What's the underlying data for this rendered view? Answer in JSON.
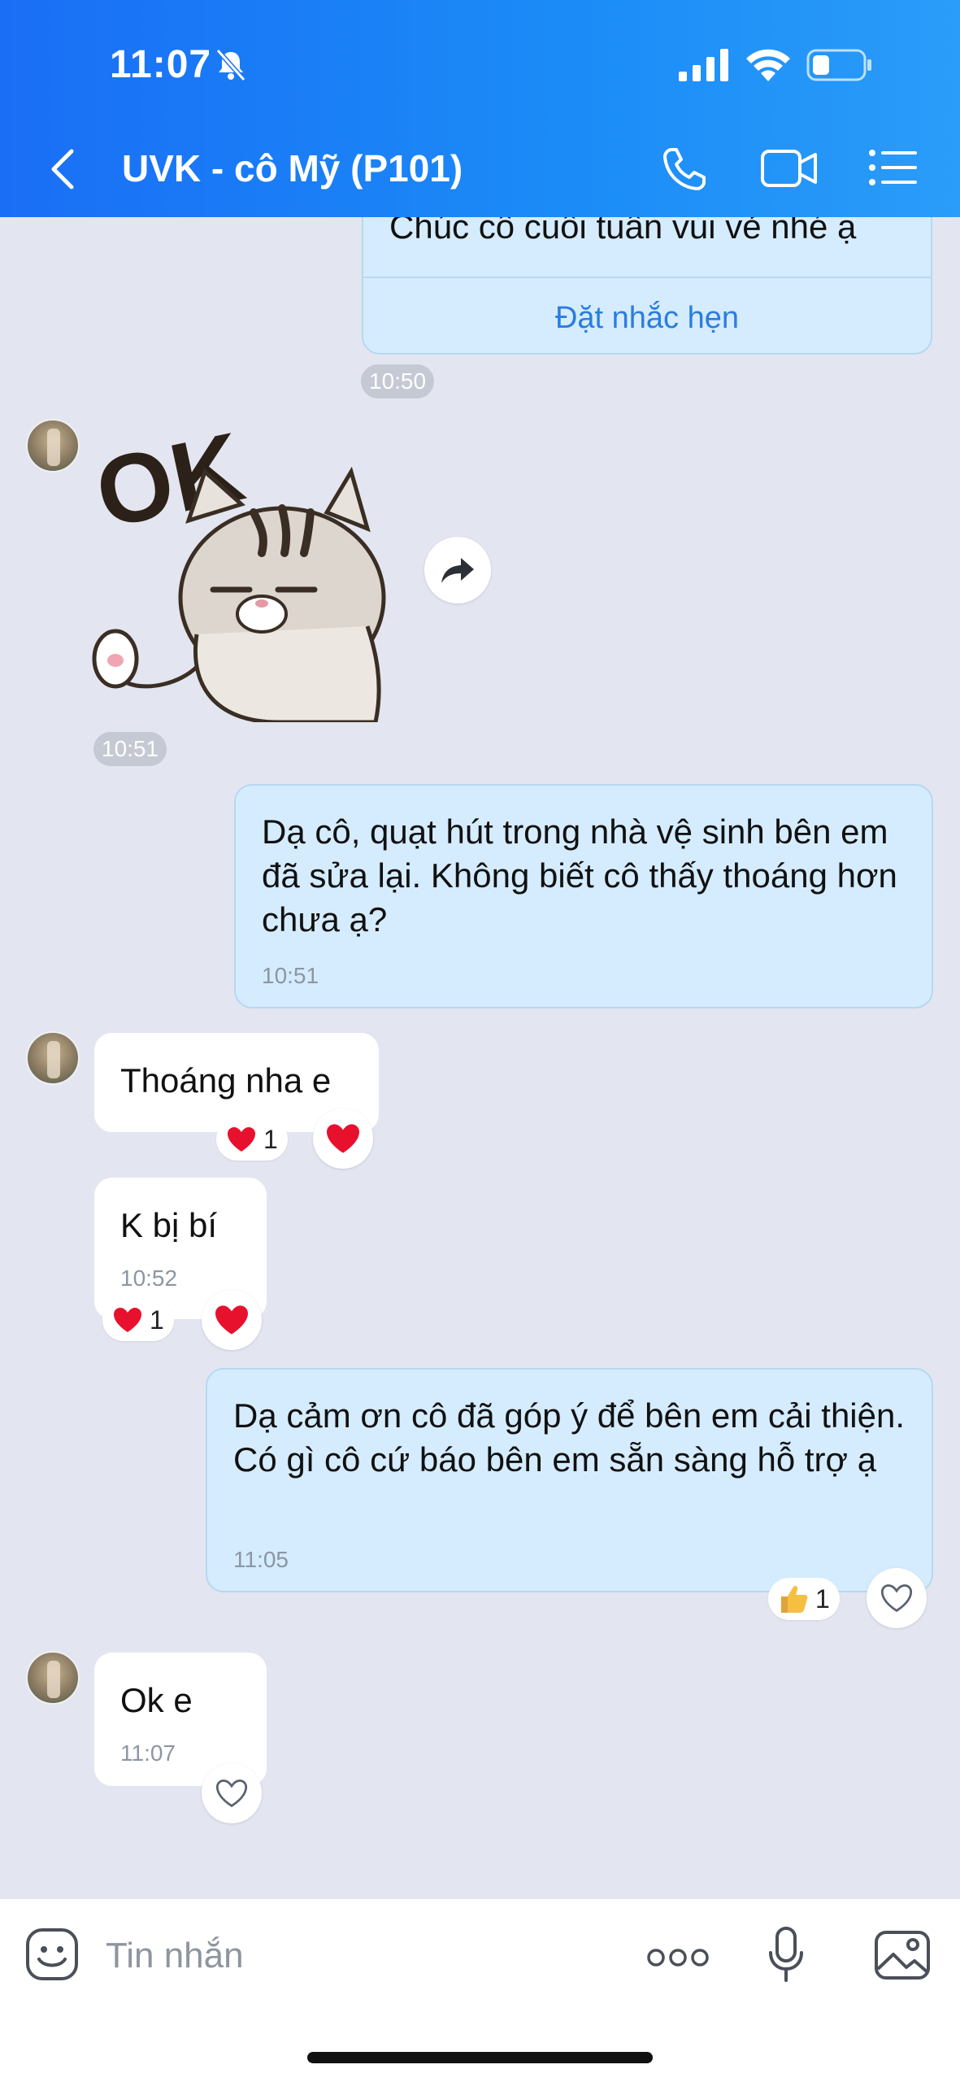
{
  "status_bar": {
    "time": "11:07"
  },
  "header": {
    "title": "UVK - cô Mỹ (P101)"
  },
  "messages": {
    "m0": {
      "text": "Chúc cô cuối tuần vui vẻ nhé ạ",
      "action": "Đặt nhắc hẹn",
      "time": "10:50"
    },
    "m1": {
      "sticker_text": "OK",
      "time": "10:51"
    },
    "m2": {
      "text": "Dạ cô, quạt hút trong nhà vệ sinh bên em đã sửa lại. Không biết cô thấy thoáng hơn chưa ạ?",
      "time": "10:51"
    },
    "m3": {
      "text": "Thoáng nha e",
      "reaction_count": "1"
    },
    "m4": {
      "text": "K bị bí",
      "time": "10:52",
      "reaction_count": "1"
    },
    "m5": {
      "text": "Dạ cảm ơn cô đã góp ý để bên em cải thiện. Có gì cô cứ báo bên em sẵn sàng hỗ trợ ạ",
      "time": "11:05",
      "reaction_count": "1"
    },
    "m6": {
      "text": "Ok e",
      "time": "11:07"
    }
  },
  "input": {
    "placeholder": "Tin nhắn"
  },
  "colors": {
    "header": "#1a7cf6",
    "outgoing_bubble": "#d5ecff",
    "incoming_bubble": "#ffffff",
    "background": "#e3e6f0",
    "link": "#2a7de1",
    "heart": "#e8112d"
  },
  "icons": [
    "bell-slash-icon",
    "signal-icon",
    "wifi-icon",
    "battery-icon",
    "back-icon",
    "phone-icon",
    "video-icon",
    "menu-icon",
    "share-icon",
    "heart-icon",
    "thumbs-up-icon",
    "emoji-icon",
    "more-icon",
    "mic-icon",
    "image-icon"
  ]
}
